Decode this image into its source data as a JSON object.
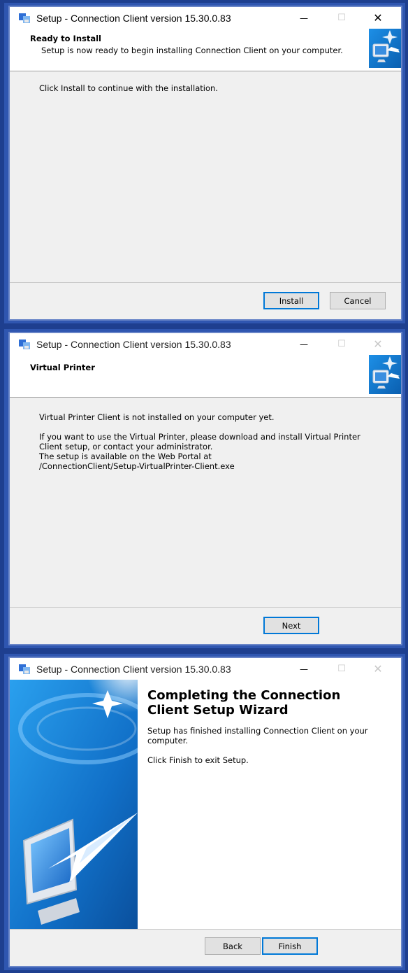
{
  "colors": {
    "accent": "#0078d7",
    "frame": "#2f56b0",
    "dialog_bg": "#f0f0f0"
  },
  "dialogs": [
    {
      "title": "Setup - Connection Client version 15.30.0.83",
      "header_title": "Ready to Install",
      "header_subtitle": "Setup is now ready to begin installing Connection Client on your computer.",
      "body_lines": [
        "Click Install to continue with the installation."
      ],
      "buttons": {
        "install": "Install",
        "cancel": "Cancel"
      }
    },
    {
      "title": "Setup - Connection Client version 15.30.0.83",
      "header_title": "Virtual Printer",
      "body_lines": [
        "Virtual Printer Client is not installed on your computer yet.",
        "If you want to use the Virtual Printer, please download and install Virtual Printer",
        "Client setup, or contact your administrator.",
        "The setup is available on the Web Portal at",
        "/ConnectionClient/Setup-VirtualPrinter-Client.exe"
      ],
      "buttons": {
        "next": "Next"
      }
    },
    {
      "title": "Setup - Connection Client version 15.30.0.83",
      "heading_line1": "Completing the Connection",
      "heading_line2": "Client Setup Wizard",
      "body_lines": [
        "Setup has finished installing Connection Client on your",
        "computer.",
        "Click Finish to exit Setup."
      ],
      "buttons": {
        "back": "Back",
        "finish": "Finish"
      }
    }
  ],
  "window_controls": {
    "minimize": "—",
    "maximize": "☐",
    "close": "✕"
  },
  "icons": [
    "setup-app-icon",
    "minimize-icon",
    "maximize-icon",
    "close-icon",
    "wizard-header-image",
    "wizard-sidebar-image"
  ]
}
